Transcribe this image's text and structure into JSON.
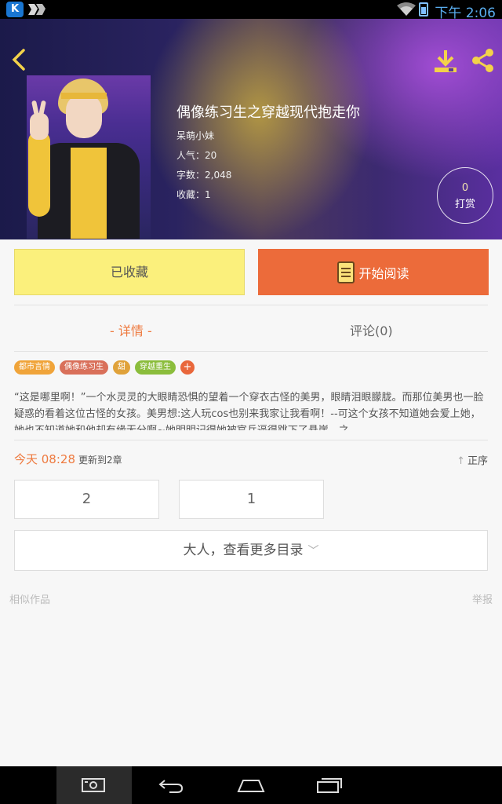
{
  "status_bar": {
    "time": "下午 2:06",
    "app_icon": "K"
  },
  "header": {
    "back_icon": "chevron-left-icon",
    "download_icon": "download-icon",
    "share_icon": "share-icon"
  },
  "book": {
    "title": "偶像练习生之穿越现代抱走你",
    "author": "呆萌小妹",
    "popularity": "人气：20",
    "word_count": "字数：2,048",
    "favorites": "收藏：1"
  },
  "tip": {
    "count": "0",
    "label": "打赏"
  },
  "actions": {
    "favorite_label": "已收藏",
    "read_label": "开始阅读"
  },
  "tabs": [
    {
      "label": "- 详情 -",
      "active": true
    },
    {
      "label": "评论(0)",
      "active": false
    }
  ],
  "tags": [
    {
      "label": "都市言情",
      "color": "#f0a43a"
    },
    {
      "label": "偶像练习生",
      "color": "#d9705a"
    },
    {
      "label": "甜",
      "color": "#e0a23a"
    },
    {
      "label": "穿越重生",
      "color": "#8bbd3c"
    }
  ],
  "tag_add": "+",
  "description": "“这是哪里啊！”一个水灵灵的大眼睛恐惧的望着一个穿衣古怪的美男，眼睛泪眼朦胧。而那位美男也一脸疑惑的看着这位古怪的女孩。美男想:这人玩cos也别来我家让我看啊！--可这个女孩不知道她会爱上她，她也不知道她和他却有缘无分啊~她明明记得她被官兵逼得跳下了悬崖，之...",
  "update": {
    "time": "今天 08:28",
    "message": "更新到2章"
  },
  "sort": {
    "arrow": "↑",
    "label": "正序"
  },
  "chapters": [
    "2",
    "1"
  ],
  "more_catalog": {
    "label": "大人，查看更多目录",
    "chevron": "﹀"
  },
  "similar_works": "相似作品",
  "report": "举报",
  "colors": {
    "accent": "#ee7a3f",
    "read_button": "#ec6b3a",
    "favorite_button": "#fbf07c"
  }
}
